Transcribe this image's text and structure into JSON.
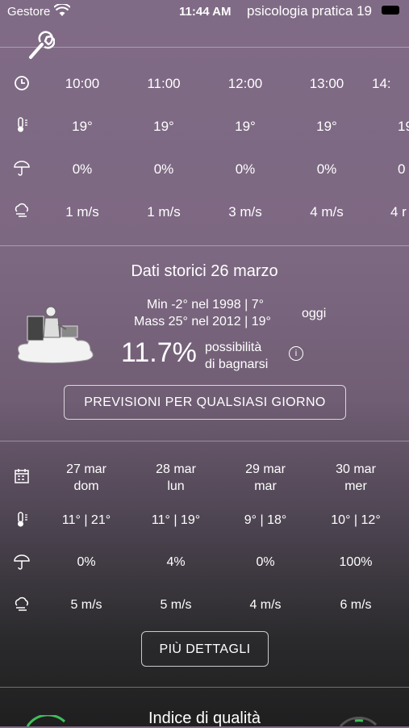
{
  "status": {
    "carrier": "Gestore",
    "time": "11:44 AM",
    "notification": "psicologia pratica 19"
  },
  "hourly": {
    "hours": [
      "10:00",
      "11:00",
      "12:00",
      "13:00",
      "14:"
    ],
    "temps": [
      "19°",
      "19°",
      "19°",
      "19°",
      "19"
    ],
    "rain": [
      "0%",
      "0%",
      "0%",
      "0%",
      "0"
    ],
    "wind": [
      "1 m/s",
      "1 m/s",
      "3 m/s",
      "4 m/s",
      "4 r"
    ]
  },
  "historical": {
    "title": "Dati storici 26 marzo",
    "min_line": "Min -2°  nel 1998 | 7°",
    "max_line": "Mass 25°  nel 2012 | 19°",
    "today": "oggi",
    "percent": "11.7%",
    "possibility_l1": "possibilità",
    "possibility_l2": "di bagnarsi",
    "info": "i",
    "button": "PREVISIONI PER QUALSIASI GIORNO"
  },
  "daily": {
    "days": [
      {
        "date": "27 mar",
        "weekday": "dom",
        "temp": "11° | 21°",
        "rain": "0%",
        "wind": "5 m/s"
      },
      {
        "date": "28 mar",
        "weekday": "lun",
        "temp": "11° | 19°",
        "rain": "4%",
        "wind": "5 m/s"
      },
      {
        "date": "29 mar",
        "weekday": "mar",
        "temp": "9° | 18°",
        "rain": "0%",
        "wind": "4 m/s"
      },
      {
        "date": "30 mar",
        "weekday": "mer",
        "temp": "10° | 12°",
        "rain": "100%",
        "wind": "6 m/s"
      }
    ],
    "button": "PIÙ DETTAGLI"
  },
  "quality_title": "Indice di qualità",
  "icons": [
    "wrench-icon",
    "clock-icon",
    "thermometer-icon",
    "umbrella-icon",
    "wind-cloud-icon",
    "calendar-icon",
    "wifi-icon",
    "battery-icon",
    "info-icon"
  ]
}
